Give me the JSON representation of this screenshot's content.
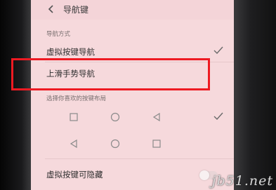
{
  "header": {
    "title": "导航键"
  },
  "section_nav_method": {
    "label": "导航方式"
  },
  "options": [
    {
      "label": "虚拟按键导航",
      "selected": true
    },
    {
      "label": "上滑手势导航",
      "selected": false
    }
  ],
  "section_layout": {
    "label": "选择你喜欢的按键布局"
  },
  "layouts": [
    {
      "symbols": [
        "square",
        "circle",
        "triangle"
      ],
      "selected": true
    },
    {
      "symbols": [
        "triangle",
        "circle",
        "square"
      ],
      "selected": false
    }
  ],
  "hide_toggle": {
    "label": "虚拟按键可隐藏",
    "on": false
  },
  "watermark": {
    "text": "jb51.net"
  },
  "colors": {
    "highlight": "#ee1a22",
    "screen": "#f6d9dc",
    "check": "#3a7bd5"
  }
}
